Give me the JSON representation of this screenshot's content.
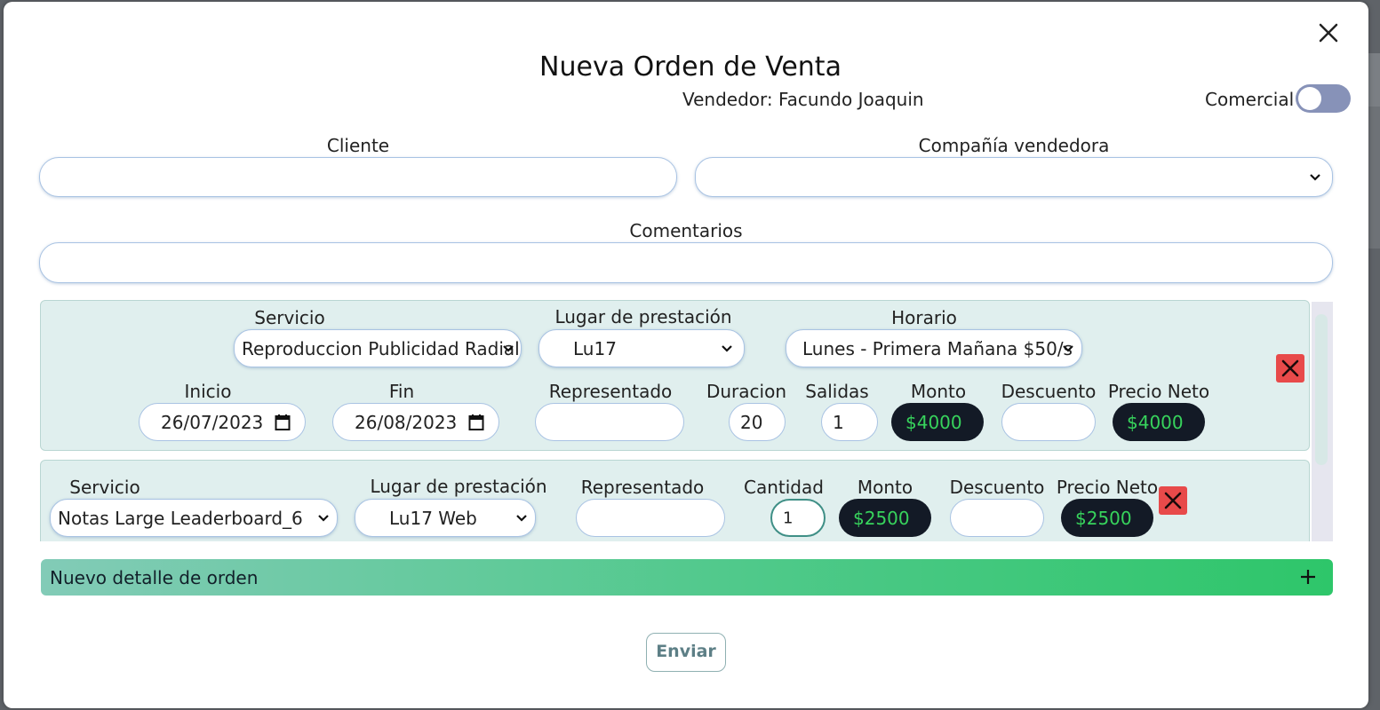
{
  "modal": {
    "title": "Nueva Orden de Venta",
    "seller": "Vendedor: Facundo Joaquin",
    "comercial_label": "Comercial",
    "comercial_on": false
  },
  "form": {
    "cliente_label": "Cliente",
    "cliente_value": "",
    "compania_label": "Compañía vendedora",
    "compania_value": "",
    "comentarios_label": "Comentarios",
    "comentarios_value": ""
  },
  "detail1": {
    "servicio_label": "Servicio",
    "servicio_value": "Reproduccion Publicidad Radial",
    "lugar_label": "Lugar de prestación",
    "lugar_value": "Lu17",
    "horario_label": "Horario",
    "horario_value": "Lunes - Primera Mañana $50/s",
    "inicio_label": "Inicio",
    "inicio_value": "26/07/2023",
    "fin_label": "Fin",
    "fin_value": "26/08/2023",
    "representado_label": "Representado",
    "representado_value": "",
    "duracion_label": "Duracion",
    "duracion_value": "20",
    "salidas_label": "Salidas",
    "salidas_value": "1",
    "monto_label": "Monto",
    "monto_value": "$4000",
    "descuento_label": "Descuento",
    "descuento_value": "",
    "neto_label": "Precio Neto",
    "neto_value": "$4000"
  },
  "detail2": {
    "servicio_label": "Servicio",
    "servicio_value": "Notas Large Leaderboard_6",
    "lugar_label": "Lugar de prestación",
    "lugar_value": "Lu17 Web",
    "representado_label": "Representado",
    "representado_value": "",
    "cantidad_label": "Cantidad",
    "cantidad_value": "1",
    "monto_label": "Monto",
    "monto_value": "$2500",
    "descuento_label": "Descuento",
    "descuento_value": "",
    "neto_label": "Precio Neto",
    "neto_value": "$2500"
  },
  "actions": {
    "new_detail_label": "Nuevo detalle de orden",
    "submit_label": "Enviar"
  },
  "colors": {
    "accent_green": "#37d35c",
    "delete_red": "#e84a4a",
    "panel_bg": "#e0efee",
    "toggle_off": "#8792b8"
  },
  "icons": {
    "close": "close-icon",
    "chevron": "chevron-down-icon",
    "calendar": "calendar-icon",
    "delete": "delete-x-icon",
    "plus": "plus-icon"
  }
}
